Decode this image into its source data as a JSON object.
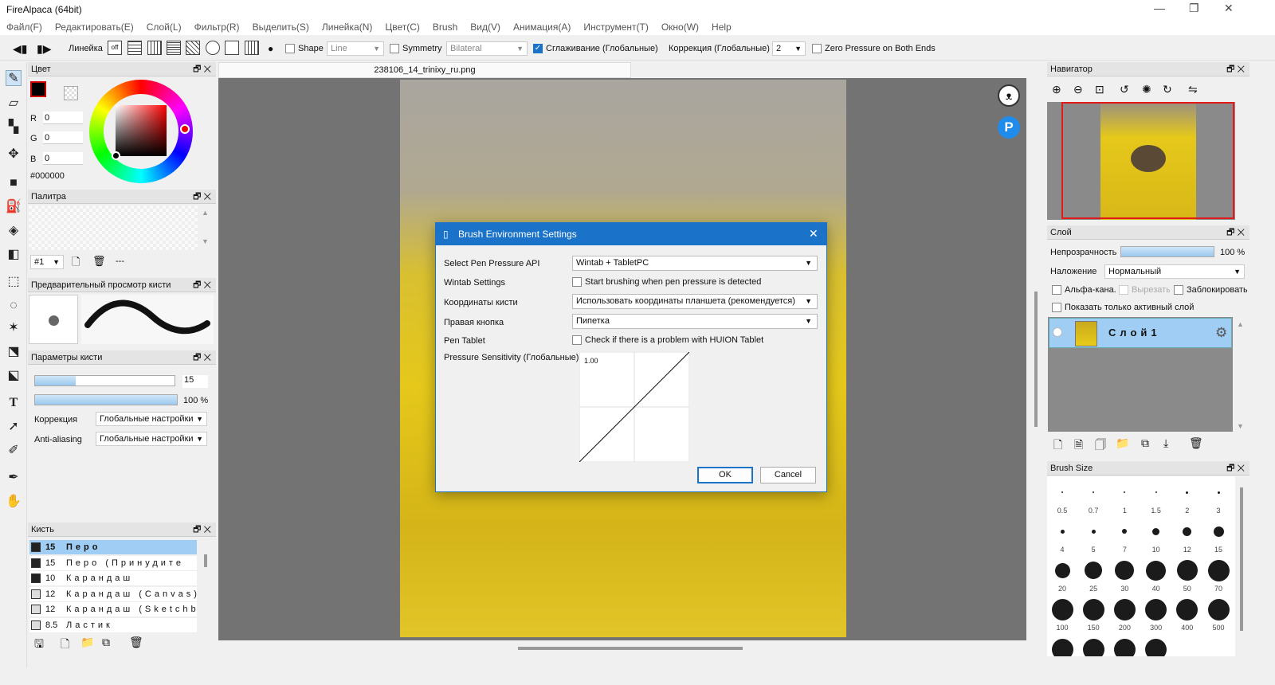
{
  "app": {
    "title": "FireAlpaca (64bit)"
  },
  "menu": [
    "Файл(F)",
    "Редактировать(E)",
    "Слой(L)",
    "Фильтр(R)",
    "Выделить(S)",
    "Линейка(N)",
    "Цвет(C)",
    "Brush",
    "Вид(V)",
    "Анимация(A)",
    "Инструмент(T)",
    "Окно(W)",
    "Help"
  ],
  "toolbar": {
    "ruler_label": "Линейка",
    "ruler_off": "off",
    "shape_label": "Shape",
    "shape_value": "Line",
    "symmetry_label": "Symmetry",
    "symmetry_value": "Bilateral",
    "smoothing_label": "Сглаживание (Глобальные)",
    "correction_label": "Коррекция (Глобальные)",
    "correction_value": "2",
    "zero_pressure_label": "Zero Pressure on Both Ends"
  },
  "color_panel": {
    "title": "Цвет",
    "r_label": "R",
    "r": "0",
    "g_label": "G",
    "g": "0",
    "b_label": "B",
    "b": "0",
    "hex": "#000000",
    "primary": "#000000"
  },
  "palette_panel": {
    "title": "Палитра",
    "index": "#1",
    "dashes": "---"
  },
  "brush_preview_panel": {
    "title": "Предварительный просмотр кисти"
  },
  "brush_params_panel": {
    "title": "Параметры кисти",
    "size": "15",
    "opacity": "100 %",
    "size_fraction": 0.29,
    "opacity_fraction": 1.0,
    "correction_label": "Коррекция",
    "correction_value": "Глобальные настройки",
    "aa_label": "Anti-aliasing",
    "aa_value": "Глобальные настройки"
  },
  "brush_panel": {
    "title": "Кисть",
    "items": [
      {
        "size": "15",
        "name": "Перо"
      },
      {
        "size": "15",
        "name": "Перо (Принудите"
      },
      {
        "size": "10",
        "name": "Карандаш"
      },
      {
        "size": "12",
        "name": "Карандаш (Canvas)"
      },
      {
        "size": "12",
        "name": "Карандаш (Sketchbook"
      },
      {
        "size": "8.5",
        "name": "Ластик"
      }
    ]
  },
  "document": {
    "tab": "238106_14_trinixy_ru.png"
  },
  "dialog": {
    "title": "Brush Environment Settings",
    "api_label": "Select Pen Pressure API",
    "api_value": "Wintab + TabletPC",
    "wintab_label": "Wintab Settings",
    "wintab_check": "Start brushing when pen pressure is detected",
    "coords_label": "Координаты кисти",
    "coords_value": "Использовать координаты планшета (рекомендуется)",
    "right_label": "Правая кнопка",
    "right_value": "Пипетка",
    "pen_label": "Pen Tablet",
    "pen_check": "Check if there is a problem with HUION Tablet",
    "sensitivity_label": "Pressure Sensitivity (Глобальные)",
    "curve_value": "1.00",
    "ok": "OK",
    "cancel": "Cancel"
  },
  "navigator_panel": {
    "title": "Навигатор"
  },
  "layer_panel": {
    "title": "Слой",
    "opacity_label": "Непрозрачность",
    "opacity_value": "100 %",
    "opacity_fraction": 1.0,
    "blend_label": "Наложение",
    "blend_value": "Нормальный",
    "alpha_label": "Альфа-кана.",
    "clip_label": "Вырезать",
    "lock_label": "Заблокировать",
    "active_only_label": "Показать только активный слой",
    "layer_name": "Слой1"
  },
  "brush_size_panel": {
    "title": "Brush Size",
    "sizes": [
      "0.5",
      "0.7",
      "1",
      "1.5",
      "2",
      "3",
      "4",
      "5",
      "7",
      "10",
      "12",
      "15",
      "20",
      "25",
      "30",
      "40",
      "50",
      "70",
      "100",
      "150",
      "200",
      "300",
      "400",
      "500"
    ]
  }
}
